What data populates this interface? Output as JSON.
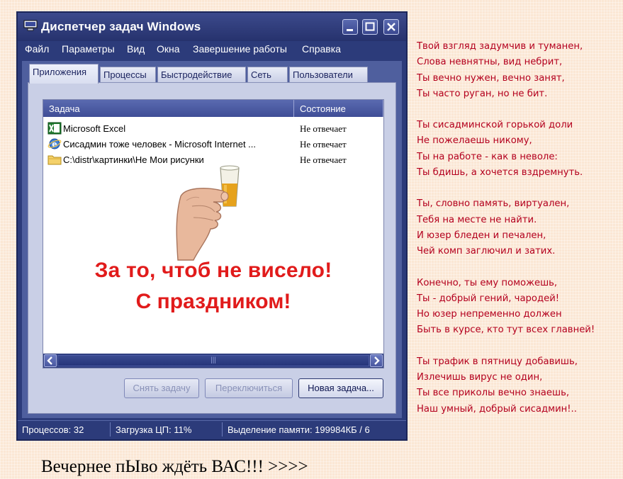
{
  "window": {
    "title": "Диспетчер задач Windows",
    "menu": [
      "Файл",
      "Параметры",
      "Вид",
      "Окна",
      "Завершение работы",
      "Справка"
    ],
    "tabs": [
      "Приложения",
      "Процессы",
      "Быстродействие",
      "Сеть",
      "Пользователи"
    ],
    "active_tab": "Приложения",
    "columns": {
      "task": "Задача",
      "status": "Состояние"
    },
    "rows": [
      {
        "icon": "excel-icon",
        "name": "Microsoft Excel",
        "status": "Не отвечает"
      },
      {
        "icon": "internet-explorer-icon",
        "name": "Сисадмин тоже человек - Microsoft Internet ...",
        "status": "Не отвечает"
      },
      {
        "icon": "folder-icon",
        "name": "C:\\distr\\картинки\\Не Мои рисунки",
        "status": "Не отвечает"
      }
    ],
    "slogan": [
      "За то, чтоб не висело!",
      "С праздником!"
    ],
    "buttons": {
      "end_task": "Снять задачу",
      "switch": "Переключиться",
      "new_task": "Новая задача..."
    },
    "status": {
      "processes": "Процессов: 32",
      "cpu": "Загрузка ЦП: 11%",
      "memory": "Выделение памяти: 199984КБ / 6"
    },
    "colors": {
      "accent": "#2c3b7a",
      "slogan": "#e11b1b",
      "poem": "#b4001e"
    }
  },
  "poem": {
    "stanzas": [
      [
        "Твой взгляд задумчив и туманен,",
        "Слова невнятны, вид небрит,",
        "Ты вечно нужен, вечно занят,",
        "Ты часто руган, но не бит."
      ],
      [
        "Ты сисадминской горькой доли",
        "Не пожелаешь никому,",
        "Ты на работе - как в неволе:",
        "Ты бдишь, а хочется вздремнуть."
      ],
      [
        "Ты, словно память, виртуален,",
        "Тебя на месте не найти.",
        "И юзер бледен и печален,",
        "Чей комп заглючил и затих."
      ],
      [
        "Конечно, ты ему поможешь,",
        "Ты - добрый гений, чародей!",
        "Но юзер непременно должен",
        "Быть в курсе, кто тут всех главней!"
      ],
      [
        "Ты трафик в пятницу добавишь,",
        "Излечишь вирус не один,",
        "Ты все приколы вечно знаешь,",
        "Наш умный, добрый сисадмин!.."
      ]
    ]
  },
  "footer": "Вечернее пЫво ждёть ВАС!!! >>>>"
}
